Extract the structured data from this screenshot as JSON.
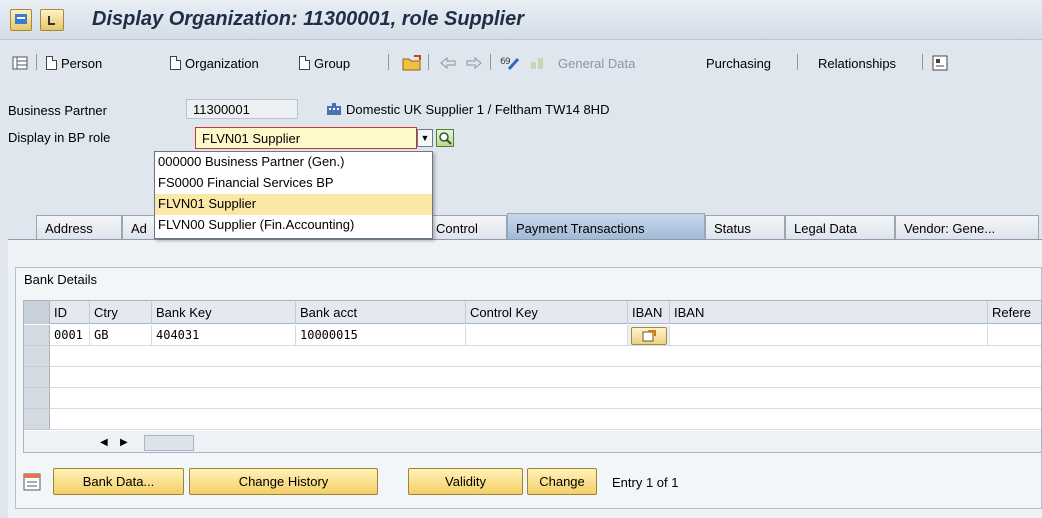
{
  "window": {
    "title": "Display Organization: 11300001, role Supplier"
  },
  "toolbar": {
    "person": "Person",
    "organization": "Organization",
    "group": "Group",
    "general_data": "General Data",
    "purchasing": "Purchasing",
    "relationships": "Relationships"
  },
  "header": {
    "bp_label": "Business Partner",
    "bp_value": "11300001",
    "bp_desc": "Domestic UK Supplier 1 / Feltham TW14 8HD",
    "role_label": "Display in BP role",
    "role_value": "FLVN01 Supplier"
  },
  "dropdown": {
    "options": [
      "000000 Business Partner (Gen.)",
      "FS0000 Financial Services BP",
      "FLVN01 Supplier",
      "FLVN00 Supplier (Fin.Accounting)"
    ],
    "selected_index": 2
  },
  "tabs": {
    "address": "Address",
    "ad_partial": "Ad",
    "control": "Control",
    "payment": "Payment Transactions",
    "status": "Status",
    "legal": "Legal Data",
    "vendor": "Vendor: Gene..."
  },
  "bank": {
    "group_title": "Bank Details",
    "columns": {
      "id": "ID",
      "ctry": "Ctry",
      "bank_key": "Bank Key",
      "bank_acct": "Bank acct",
      "control_key": "Control Key",
      "iban_btn": "IBAN",
      "iban": "IBAN",
      "reference": "Refere"
    },
    "rows": [
      {
        "id": "0001",
        "ctry": "GB",
        "bank_key": "404031",
        "bank_acct": "10000015"
      }
    ]
  },
  "actions": {
    "bank_data": "Bank Data...",
    "change_history": "Change History",
    "validity": "Validity",
    "change": "Change",
    "entry": "Entry 1 of 1"
  }
}
